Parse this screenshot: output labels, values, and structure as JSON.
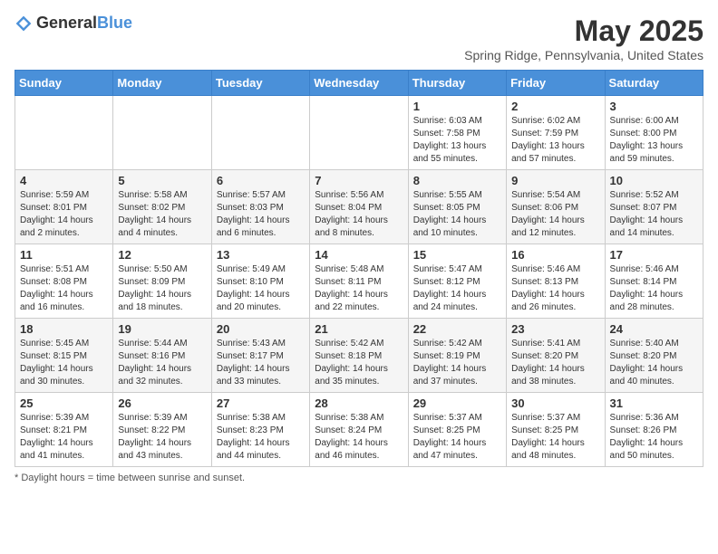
{
  "header": {
    "logo_general": "General",
    "logo_blue": "Blue",
    "month_title": "May 2025",
    "location": "Spring Ridge, Pennsylvania, United States"
  },
  "footer": {
    "note": "Daylight hours"
  },
  "weekdays": [
    "Sunday",
    "Monday",
    "Tuesday",
    "Wednesday",
    "Thursday",
    "Friday",
    "Saturday"
  ],
  "weeks": [
    [
      {
        "day": "",
        "info": ""
      },
      {
        "day": "",
        "info": ""
      },
      {
        "day": "",
        "info": ""
      },
      {
        "day": "",
        "info": ""
      },
      {
        "day": "1",
        "info": "Sunrise: 6:03 AM\nSunset: 7:58 PM\nDaylight: 13 hours\nand 55 minutes."
      },
      {
        "day": "2",
        "info": "Sunrise: 6:02 AM\nSunset: 7:59 PM\nDaylight: 13 hours\nand 57 minutes."
      },
      {
        "day": "3",
        "info": "Sunrise: 6:00 AM\nSunset: 8:00 PM\nDaylight: 13 hours\nand 59 minutes."
      }
    ],
    [
      {
        "day": "4",
        "info": "Sunrise: 5:59 AM\nSunset: 8:01 PM\nDaylight: 14 hours\nand 2 minutes."
      },
      {
        "day": "5",
        "info": "Sunrise: 5:58 AM\nSunset: 8:02 PM\nDaylight: 14 hours\nand 4 minutes."
      },
      {
        "day": "6",
        "info": "Sunrise: 5:57 AM\nSunset: 8:03 PM\nDaylight: 14 hours\nand 6 minutes."
      },
      {
        "day": "7",
        "info": "Sunrise: 5:56 AM\nSunset: 8:04 PM\nDaylight: 14 hours\nand 8 minutes."
      },
      {
        "day": "8",
        "info": "Sunrise: 5:55 AM\nSunset: 8:05 PM\nDaylight: 14 hours\nand 10 minutes."
      },
      {
        "day": "9",
        "info": "Sunrise: 5:54 AM\nSunset: 8:06 PM\nDaylight: 14 hours\nand 12 minutes."
      },
      {
        "day": "10",
        "info": "Sunrise: 5:52 AM\nSunset: 8:07 PM\nDaylight: 14 hours\nand 14 minutes."
      }
    ],
    [
      {
        "day": "11",
        "info": "Sunrise: 5:51 AM\nSunset: 8:08 PM\nDaylight: 14 hours\nand 16 minutes."
      },
      {
        "day": "12",
        "info": "Sunrise: 5:50 AM\nSunset: 8:09 PM\nDaylight: 14 hours\nand 18 minutes."
      },
      {
        "day": "13",
        "info": "Sunrise: 5:49 AM\nSunset: 8:10 PM\nDaylight: 14 hours\nand 20 minutes."
      },
      {
        "day": "14",
        "info": "Sunrise: 5:48 AM\nSunset: 8:11 PM\nDaylight: 14 hours\nand 22 minutes."
      },
      {
        "day": "15",
        "info": "Sunrise: 5:47 AM\nSunset: 8:12 PM\nDaylight: 14 hours\nand 24 minutes."
      },
      {
        "day": "16",
        "info": "Sunrise: 5:46 AM\nSunset: 8:13 PM\nDaylight: 14 hours\nand 26 minutes."
      },
      {
        "day": "17",
        "info": "Sunrise: 5:46 AM\nSunset: 8:14 PM\nDaylight: 14 hours\nand 28 minutes."
      }
    ],
    [
      {
        "day": "18",
        "info": "Sunrise: 5:45 AM\nSunset: 8:15 PM\nDaylight: 14 hours\nand 30 minutes."
      },
      {
        "day": "19",
        "info": "Sunrise: 5:44 AM\nSunset: 8:16 PM\nDaylight: 14 hours\nand 32 minutes."
      },
      {
        "day": "20",
        "info": "Sunrise: 5:43 AM\nSunset: 8:17 PM\nDaylight: 14 hours\nand 33 minutes."
      },
      {
        "day": "21",
        "info": "Sunrise: 5:42 AM\nSunset: 8:18 PM\nDaylight: 14 hours\nand 35 minutes."
      },
      {
        "day": "22",
        "info": "Sunrise: 5:42 AM\nSunset: 8:19 PM\nDaylight: 14 hours\nand 37 minutes."
      },
      {
        "day": "23",
        "info": "Sunrise: 5:41 AM\nSunset: 8:20 PM\nDaylight: 14 hours\nand 38 minutes."
      },
      {
        "day": "24",
        "info": "Sunrise: 5:40 AM\nSunset: 8:20 PM\nDaylight: 14 hours\nand 40 minutes."
      }
    ],
    [
      {
        "day": "25",
        "info": "Sunrise: 5:39 AM\nSunset: 8:21 PM\nDaylight: 14 hours\nand 41 minutes."
      },
      {
        "day": "26",
        "info": "Sunrise: 5:39 AM\nSunset: 8:22 PM\nDaylight: 14 hours\nand 43 minutes."
      },
      {
        "day": "27",
        "info": "Sunrise: 5:38 AM\nSunset: 8:23 PM\nDaylight: 14 hours\nand 44 minutes."
      },
      {
        "day": "28",
        "info": "Sunrise: 5:38 AM\nSunset: 8:24 PM\nDaylight: 14 hours\nand 46 minutes."
      },
      {
        "day": "29",
        "info": "Sunrise: 5:37 AM\nSunset: 8:25 PM\nDaylight: 14 hours\nand 47 minutes."
      },
      {
        "day": "30",
        "info": "Sunrise: 5:37 AM\nSunset: 8:25 PM\nDaylight: 14 hours\nand 48 minutes."
      },
      {
        "day": "31",
        "info": "Sunrise: 5:36 AM\nSunset: 8:26 PM\nDaylight: 14 hours\nand 50 minutes."
      }
    ]
  ]
}
